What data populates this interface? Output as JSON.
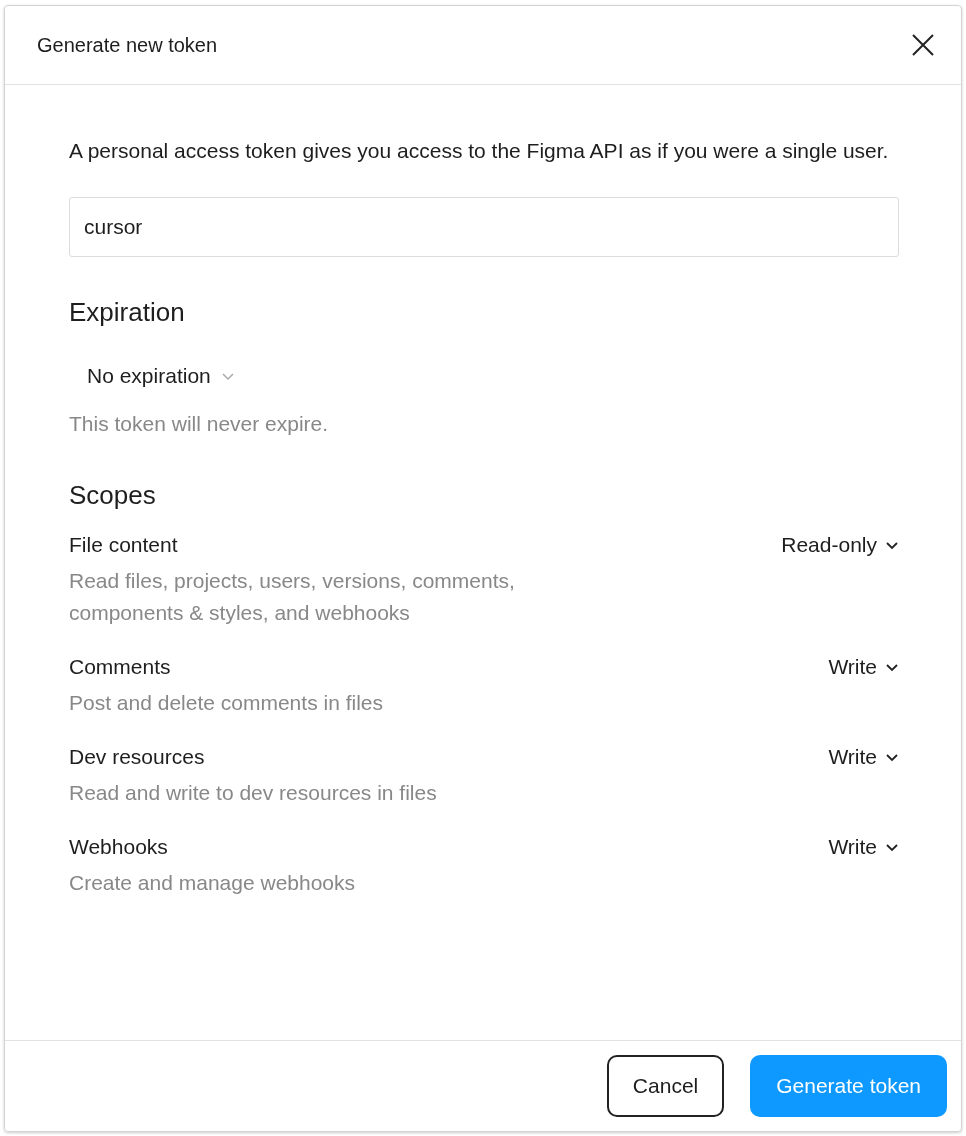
{
  "dialog": {
    "title": "Generate new token"
  },
  "intro": "A personal access token gives you access to the Figma API as if you were a single user.",
  "token_name": {
    "value": "cursor"
  },
  "expiration": {
    "heading": "Expiration",
    "selected": "No expiration",
    "note": "This token will never expire."
  },
  "scopes": {
    "heading": "Scopes",
    "items": [
      {
        "name": "File content",
        "description": "Read files, projects, users, versions, comments, components & styles, and webhooks",
        "access": "Read-only"
      },
      {
        "name": "Comments",
        "description": "Post and delete comments in files",
        "access": "Write"
      },
      {
        "name": "Dev resources",
        "description": "Read and write to dev resources in files",
        "access": "Write"
      },
      {
        "name": "Webhooks",
        "description": "Create and manage webhooks",
        "access": "Write"
      }
    ]
  },
  "buttons": [
    {
      "label": "Cancel",
      "kind": "secondary"
    },
    {
      "label": "Generate token",
      "kind": "primary"
    }
  ]
}
